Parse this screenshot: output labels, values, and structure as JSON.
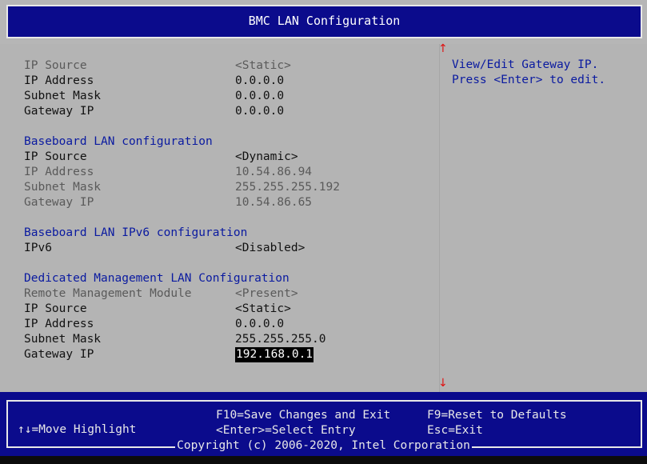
{
  "header": {
    "title": "BMC LAN Configuration"
  },
  "colors": {
    "header_bg": "#0b0b8c",
    "panel_bg": "#b4b4b4",
    "section_text": "#0a1aa0",
    "scroll_arrow": "#e01010",
    "highlight_bg": "#000000"
  },
  "top_group": {
    "rows": [
      {
        "label": "IP Source",
        "value": "<Static>"
      },
      {
        "label": "IP Address",
        "value": "0.0.0.0"
      },
      {
        "label": "Subnet Mask",
        "value": "0.0.0.0"
      },
      {
        "label": "Gateway IP",
        "value": "0.0.0.0"
      }
    ]
  },
  "baseboard": {
    "title": "Baseboard LAN configuration",
    "rows": [
      {
        "label": "IP Source",
        "value": "<Dynamic>"
      },
      {
        "label": "IP Address",
        "value": "10.54.86.94"
      },
      {
        "label": "Subnet Mask",
        "value": "255.255.255.192"
      },
      {
        "label": "Gateway IP",
        "value": "10.54.86.65"
      }
    ]
  },
  "ipv6": {
    "title": "Baseboard LAN IPv6 configuration",
    "rows": [
      {
        "label": "IPv6",
        "value": "<Disabled>"
      }
    ]
  },
  "dedicated": {
    "title": "Dedicated Management LAN Configuration",
    "rows": [
      {
        "label": "Remote Management Module",
        "value": "<Present>"
      },
      {
        "label": "IP Source",
        "value": "<Static>"
      },
      {
        "label": "IP Address",
        "value": "0.0.0.0"
      },
      {
        "label": "Subnet Mask",
        "value": "255.255.255.0"
      },
      {
        "label": "Gateway IP",
        "value": "192.168.0.1"
      }
    ]
  },
  "help": {
    "text": "View/Edit Gateway IP. Press <Enter> to edit."
  },
  "scroll": {
    "up": "↑",
    "down": "↓"
  },
  "footer": {
    "move": "↑↓=Move Highlight",
    "save": "F10=Save Changes and Exit",
    "select": "<Enter>=Select Entry",
    "reset": "F9=Reset to Defaults",
    "exit": "Esc=Exit",
    "copyright": "Copyright (c) 2006-2020, Intel Corporation"
  }
}
